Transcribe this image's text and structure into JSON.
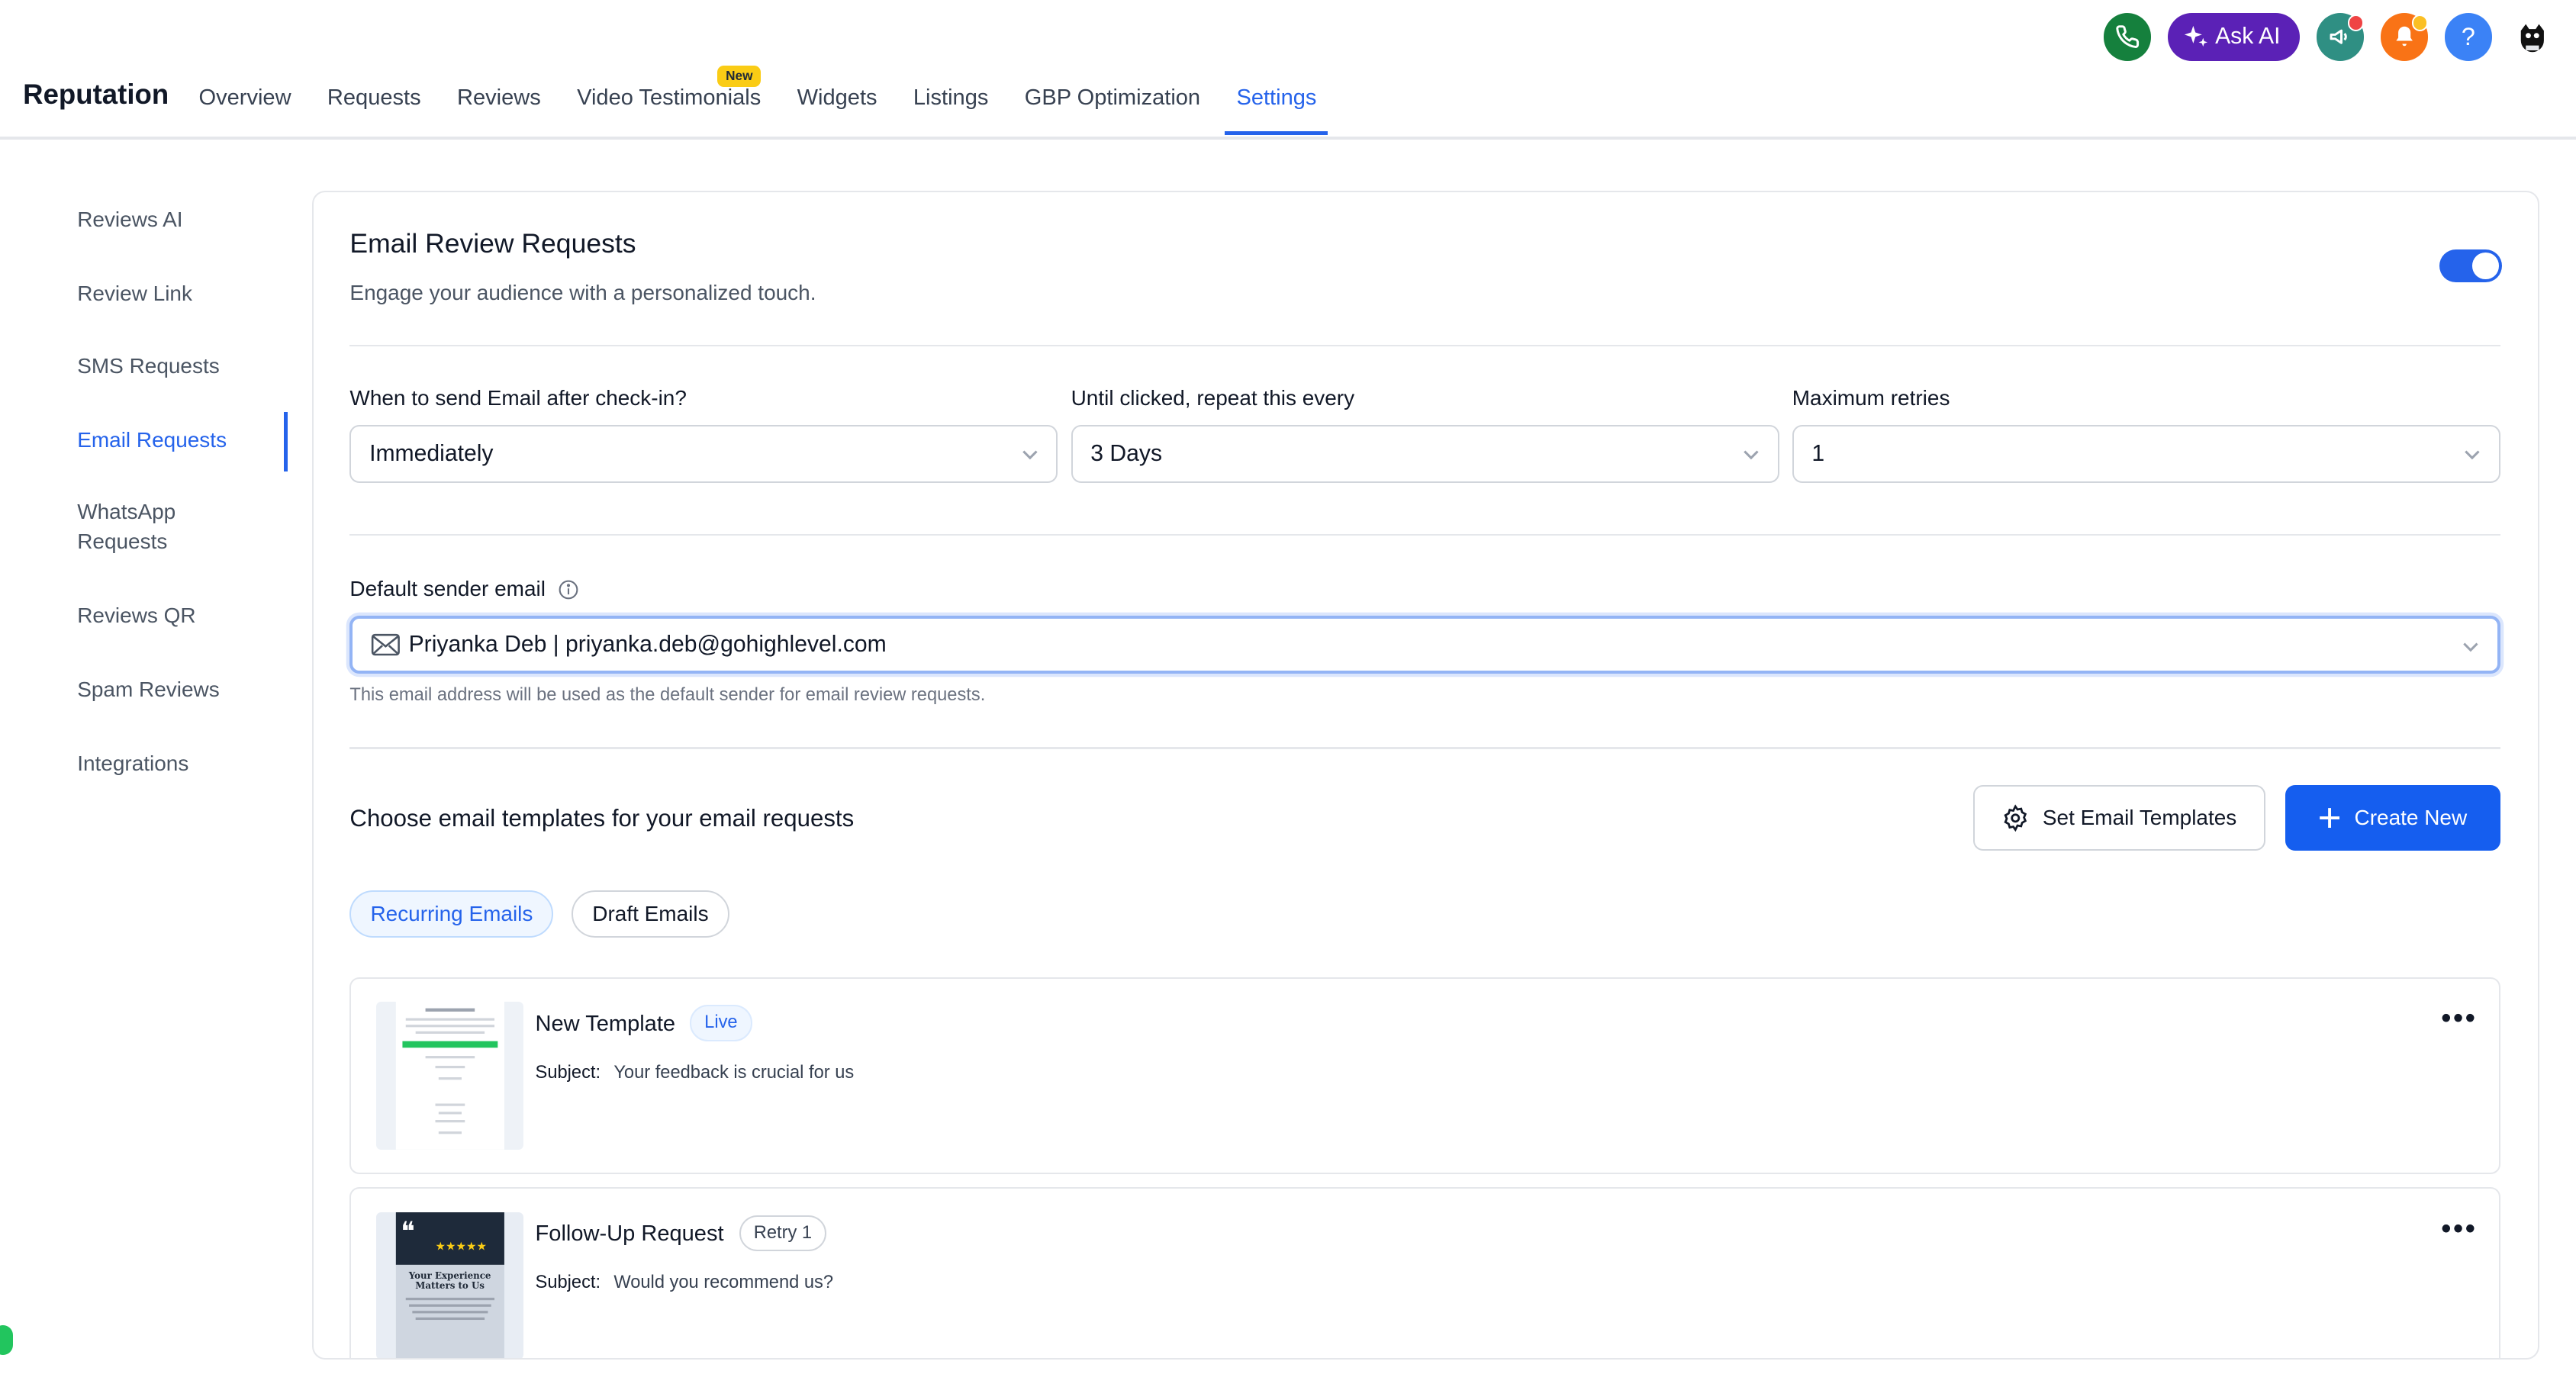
{
  "app": {
    "brand": "Reputation",
    "nav": [
      {
        "label": "Overview"
      },
      {
        "label": "Requests"
      },
      {
        "label": "Reviews"
      },
      {
        "label": "Video Testimonials",
        "badge": "New"
      },
      {
        "label": "Widgets"
      },
      {
        "label": "Listings"
      },
      {
        "label": "GBP Optimization"
      },
      {
        "label": "Settings",
        "active": true
      }
    ],
    "top_icons": {
      "phone": "phone-icon",
      "ask_ai_label": "Ask AI",
      "megaphone": "megaphone-icon",
      "bell": "bell-icon",
      "help": "?",
      "avatar": "avatar-icon"
    }
  },
  "sidebar": {
    "items": [
      {
        "label": "Reviews AI"
      },
      {
        "label": "Review Link"
      },
      {
        "label": "SMS Requests"
      },
      {
        "label": "Email Requests",
        "active": true
      },
      {
        "label": "WhatsApp Requests"
      },
      {
        "label": "Reviews QR"
      },
      {
        "label": "Spam Reviews"
      },
      {
        "label": "Integrations"
      }
    ]
  },
  "main": {
    "title": "Email Review Requests",
    "subtitle": "Engage your audience with a personalized touch.",
    "enabled": true,
    "fields": {
      "send_label": "When to send Email after check-in?",
      "send_value": "Immediately",
      "repeat_label": "Until clicked, repeat this every",
      "repeat_value": "3 Days",
      "retries_label": "Maximum retries",
      "retries_value": "1"
    },
    "sender": {
      "label": "Default sender email",
      "value": "Priyanka Deb | priyanka.deb@gohighlevel.com",
      "help": "This email address will be used as the default sender for email review requests."
    },
    "templates": {
      "section_title": "Choose email templates for your email requests",
      "set_button": "Set Email Templates",
      "create_button": "Create New",
      "tabs": [
        "Recurring Emails",
        "Draft Emails"
      ],
      "subject_label": "Subject:",
      "items": [
        {
          "name": "New Template",
          "badge": "Live",
          "subject": "Your feedback is crucial for us"
        },
        {
          "name": "Follow-Up Request",
          "badge": "Retry 1",
          "subject": "Would you recommend us?"
        }
      ],
      "thumb_text": "Your Experience Matters to Us",
      "more_glyph": "•••"
    }
  },
  "colors": {
    "accent": "#2563eb",
    "primary_button": "#155eef",
    "ask_ai": "#5b21b6",
    "phone": "#16a34a",
    "bell": "#f97316",
    "help": "#3b82f6"
  }
}
